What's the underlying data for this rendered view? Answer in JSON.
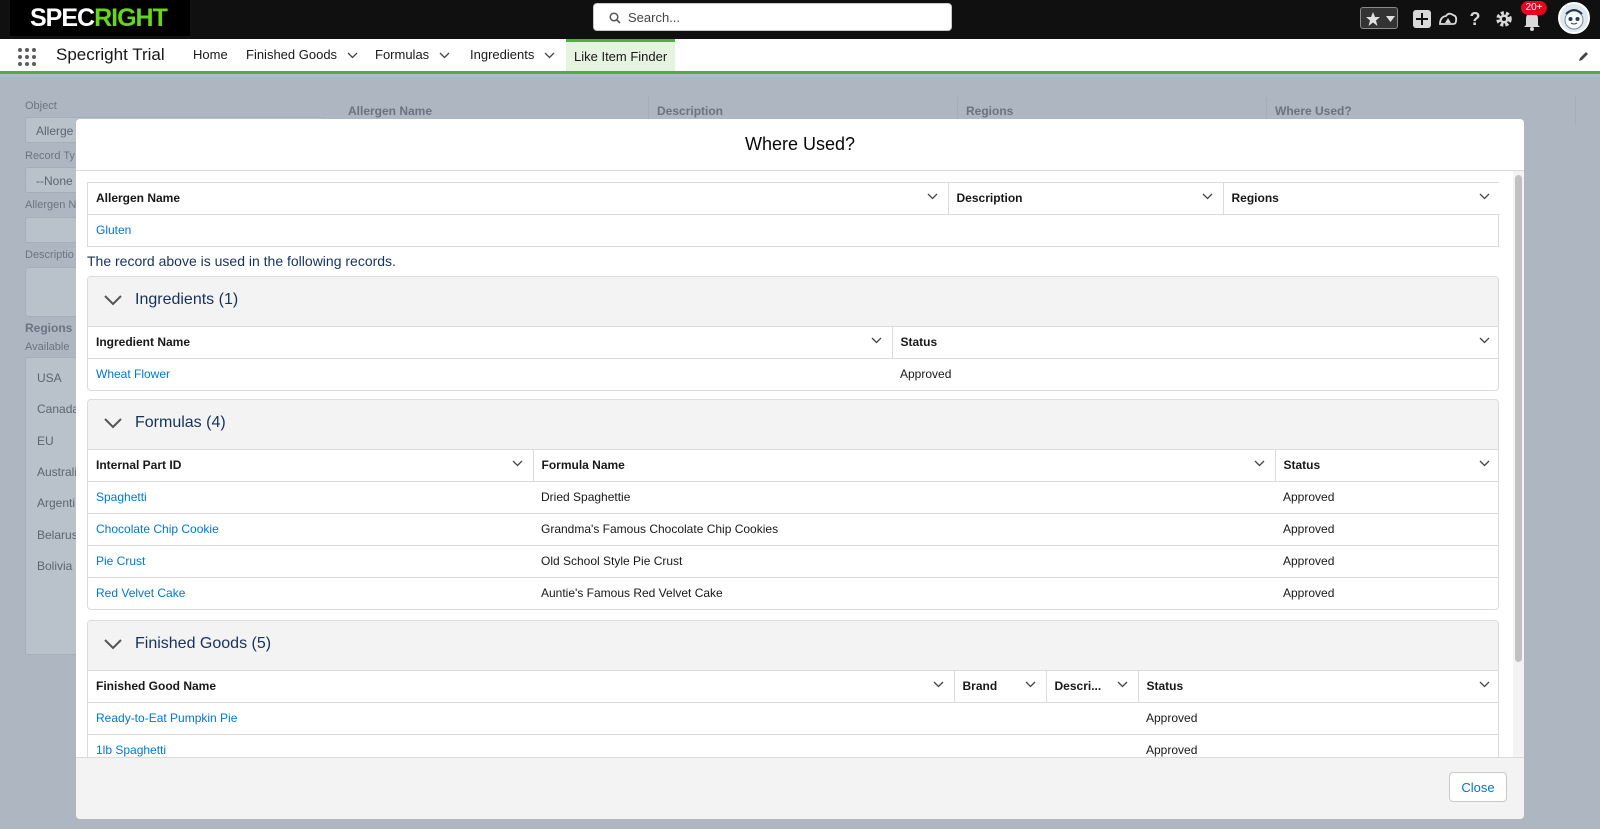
{
  "header": {
    "logo_part1": "SPEC",
    "logo_part2": "RIGHT",
    "search_placeholder": "Search...",
    "notification_count": "20+",
    "icons": [
      "favorites-star-icon",
      "add-icon",
      "trailhead-icon",
      "help-icon",
      "setup-gear-icon",
      "notifications-bell-icon"
    ]
  },
  "nav": {
    "app_name": "Specright Trial",
    "items": [
      {
        "label": "Home",
        "has_menu": false
      },
      {
        "label": "Finished Goods",
        "has_menu": true
      },
      {
        "label": "Formulas",
        "has_menu": true
      },
      {
        "label": "Ingredients",
        "has_menu": true
      },
      {
        "label": "Like Item Finder",
        "has_menu": false,
        "active": true
      }
    ]
  },
  "background": {
    "object_label": "Object",
    "object_value": "Allerge",
    "record_type_label": "Record Ty",
    "record_type_value": "--None",
    "allergen_label": "Allergen N",
    "description_label": "Descriptio",
    "regions_label": "Regions",
    "available_label": "Available",
    "regions": [
      "USA",
      "Canada",
      "EU",
      "Australi",
      "Argenti",
      "Belarus",
      "Bolivia"
    ],
    "columns": [
      "Allergen Name",
      "Description",
      "Regions",
      "Where Used?"
    ]
  },
  "modal": {
    "title": "Where Used?",
    "record_table": {
      "columns": [
        "Allergen Name",
        "Description",
        "Regions"
      ],
      "row": {
        "name": "Gluten",
        "description": "",
        "regions": ""
      }
    },
    "note": "The record above is used in the following records.",
    "ingredients": {
      "title": "Ingredients (1)",
      "columns": [
        "Ingredient Name",
        "Status"
      ],
      "rows": [
        {
          "name": "Wheat Flower",
          "status": "Approved"
        }
      ]
    },
    "formulas": {
      "title": "Formulas (4)",
      "columns": [
        "Internal Part ID",
        "Formula Name",
        "Status"
      ],
      "rows": [
        {
          "id": "Spaghetti",
          "name": "Dried Spaghettie",
          "status": "Approved"
        },
        {
          "id": "Chocolate Chip Cookie",
          "name": "Grandma's Famous Chocolate Chip Cookies",
          "status": "Approved"
        },
        {
          "id": "Pie Crust",
          "name": "Old School Style Pie Crust",
          "status": "Approved"
        },
        {
          "id": "Red Velvet Cake",
          "name": "Auntie's Famous Red Velvet Cake",
          "status": "Approved"
        }
      ]
    },
    "finished_goods": {
      "title": "Finished Goods (5)",
      "columns": [
        "Finished Good Name",
        "Brand",
        "Descri...",
        "Status"
      ],
      "rows": [
        {
          "name": "Ready-to-Eat Pumpkin Pie",
          "brand": "",
          "description": "",
          "status": "Approved"
        },
        {
          "name": "1lb Spaghetti",
          "brand": "",
          "description": "",
          "status": "Approved"
        }
      ]
    },
    "close_label": "Close"
  },
  "colors": {
    "brand_green": "#66d51c",
    "nav_accent": "#4bb13b",
    "link_blue": "#0176d3",
    "badge_red": "#ea001e"
  }
}
